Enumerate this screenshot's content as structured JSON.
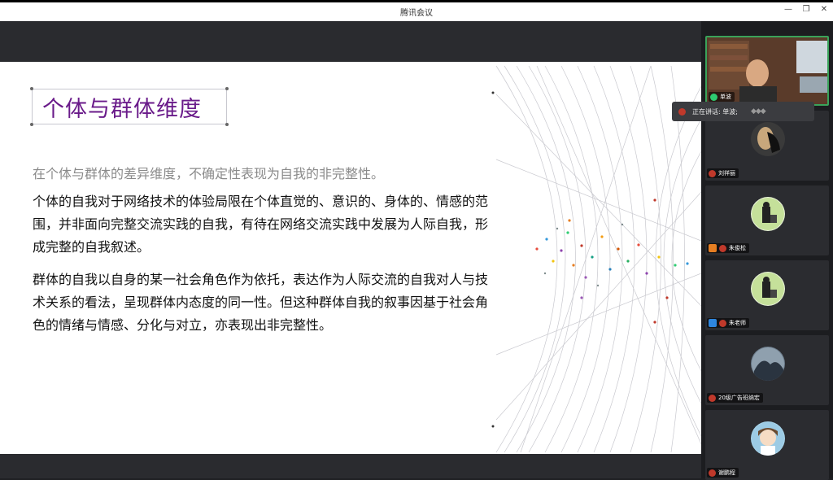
{
  "window": {
    "title": "腾讯会议"
  },
  "slide": {
    "title": "个体与群体维度",
    "subtitle": "在个体与群体的差异维度，不确定性表现为自我的非完整性。",
    "paragraph1": "个体的自我对于网络技术的体验局限在个体直觉的、意识的、身体的、情感的范围，并非面向完整交流实践的自我，有待在网络交流实践中发展为人际自我，形成完整的自我叙述。",
    "paragraph2": "群体的自我以自身的某一社会角色作为依托，表达作为人际交流的自我对人与技术关系的看法，呈现群体内态度的同一性。但这种群体自我的叙事因基于社会角色的情绪与情感、分化与对立，亦表现出非完整性。"
  },
  "speaking_indicator": {
    "label": "正在讲话: 单波;"
  },
  "participants": [
    {
      "name": "单波",
      "active": true
    },
    {
      "name": "刘祥丽",
      "active": false
    },
    {
      "name": "朱俊松",
      "active": false
    },
    {
      "name": "朱老师",
      "active": false
    },
    {
      "name": "20级广告班纳宏",
      "active": false
    },
    {
      "name": "谢鹏程",
      "active": false
    }
  ],
  "colors": {
    "accent_title": "#6a1b8a",
    "active_border": "#3aa35a"
  }
}
